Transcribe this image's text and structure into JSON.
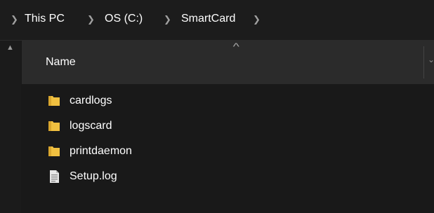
{
  "breadcrumb": {
    "items": [
      {
        "label": "This PC"
      },
      {
        "label": "OS (C:)"
      },
      {
        "label": "SmartCard"
      }
    ],
    "separator_icon": "chevron-right-icon"
  },
  "file_list": {
    "columns": [
      {
        "label": "Name",
        "sorted": "ascending"
      }
    ],
    "items": [
      {
        "name": "cardlogs",
        "type": "folder",
        "icon": "folder-icon"
      },
      {
        "name": "logscard",
        "type": "folder",
        "icon": "folder-icon"
      },
      {
        "name": "printdaemon",
        "type": "folder",
        "icon": "folder-icon"
      },
      {
        "name": "Setup.log",
        "type": "file",
        "icon": "text-file-icon"
      }
    ]
  },
  "colors": {
    "background": "#191919",
    "header_background": "#2b2b2b",
    "folder": "#f0c040",
    "text": "#ffffff"
  }
}
